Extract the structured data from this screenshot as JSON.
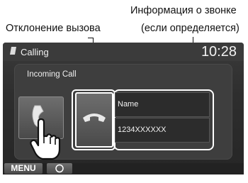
{
  "annotations": {
    "caller_info_line1": "Информация о звонке",
    "caller_info_line2": "(если определяется)",
    "reject": "Отклонение вызова"
  },
  "screen": {
    "title": "Calling",
    "time": "10:28",
    "incoming_label": "Incoming Call",
    "caller_name": "Name",
    "caller_number": "1234XXXXXX",
    "menu_label": "MENU"
  },
  "colors": {
    "screen_bg": "#2e2e2e",
    "panel_bg": "#3e3e3e",
    "text": "#f2f2f2",
    "highlight_frame": "#ffffff"
  },
  "icons": [
    "phone-note-icon",
    "accept-call-icon",
    "reject-call-icon",
    "hand-pointer-icon",
    "home-icon"
  ]
}
